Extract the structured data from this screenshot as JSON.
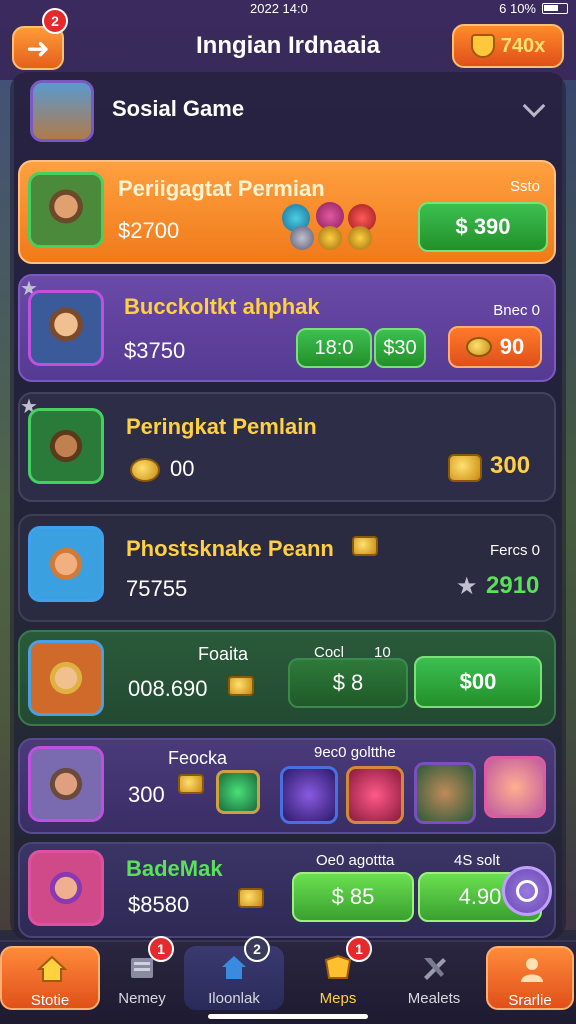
{
  "status": {
    "time": "2022 14:0",
    "battery": "6 10%"
  },
  "header": {
    "title": "Inngian Irdnaaia",
    "back_badge": "2",
    "coins": "740x"
  },
  "social": {
    "label": "Sosial Game"
  },
  "cards": [
    {
      "name": "Periigagtat Permian",
      "value": "$2700",
      "right_tag": "Ssto",
      "button": "$ 390"
    },
    {
      "name": "Bucckoltkt ahphak",
      "value": "$3750",
      "right_tag": "Bnec 0",
      "btn_a": "18:0",
      "btn_b": "$30",
      "btn_c": "90"
    },
    {
      "name": "Peringkat Pemlain",
      "value": "00",
      "right_value": "300"
    },
    {
      "name": "Phostsknake Peann",
      "value": "75755",
      "right_tag": "Fercs 0",
      "right_value": "2910"
    },
    {
      "name": "Foaita",
      "value": "008.690",
      "right_tag_a": "Cocl",
      "right_tag_b": "10",
      "btn_a": "$ 8",
      "btn_b": "$00"
    },
    {
      "name": "Feocka",
      "value": "300",
      "right_tag": "9ec0 goltthe"
    },
    {
      "name": "BadeMak",
      "value": "$8580",
      "right_tag_a": "Oe0 agottta",
      "right_tag_b": "4S solt",
      "btn_a": "$ 85",
      "btn_b": "4.90"
    }
  ],
  "nav": [
    {
      "label": "Stotie",
      "badge": ""
    },
    {
      "label": "Nemey",
      "badge": "1"
    },
    {
      "label": "Iloonlak",
      "badge": "2"
    },
    {
      "label": "Meps",
      "badge": "1"
    },
    {
      "label": "Mealets",
      "badge": ""
    },
    {
      "label": "Srarlie",
      "badge": ""
    }
  ],
  "colors": {
    "accent_orange": "#f07a1a",
    "accent_green": "#3cc050",
    "gold": "#ffd040"
  }
}
